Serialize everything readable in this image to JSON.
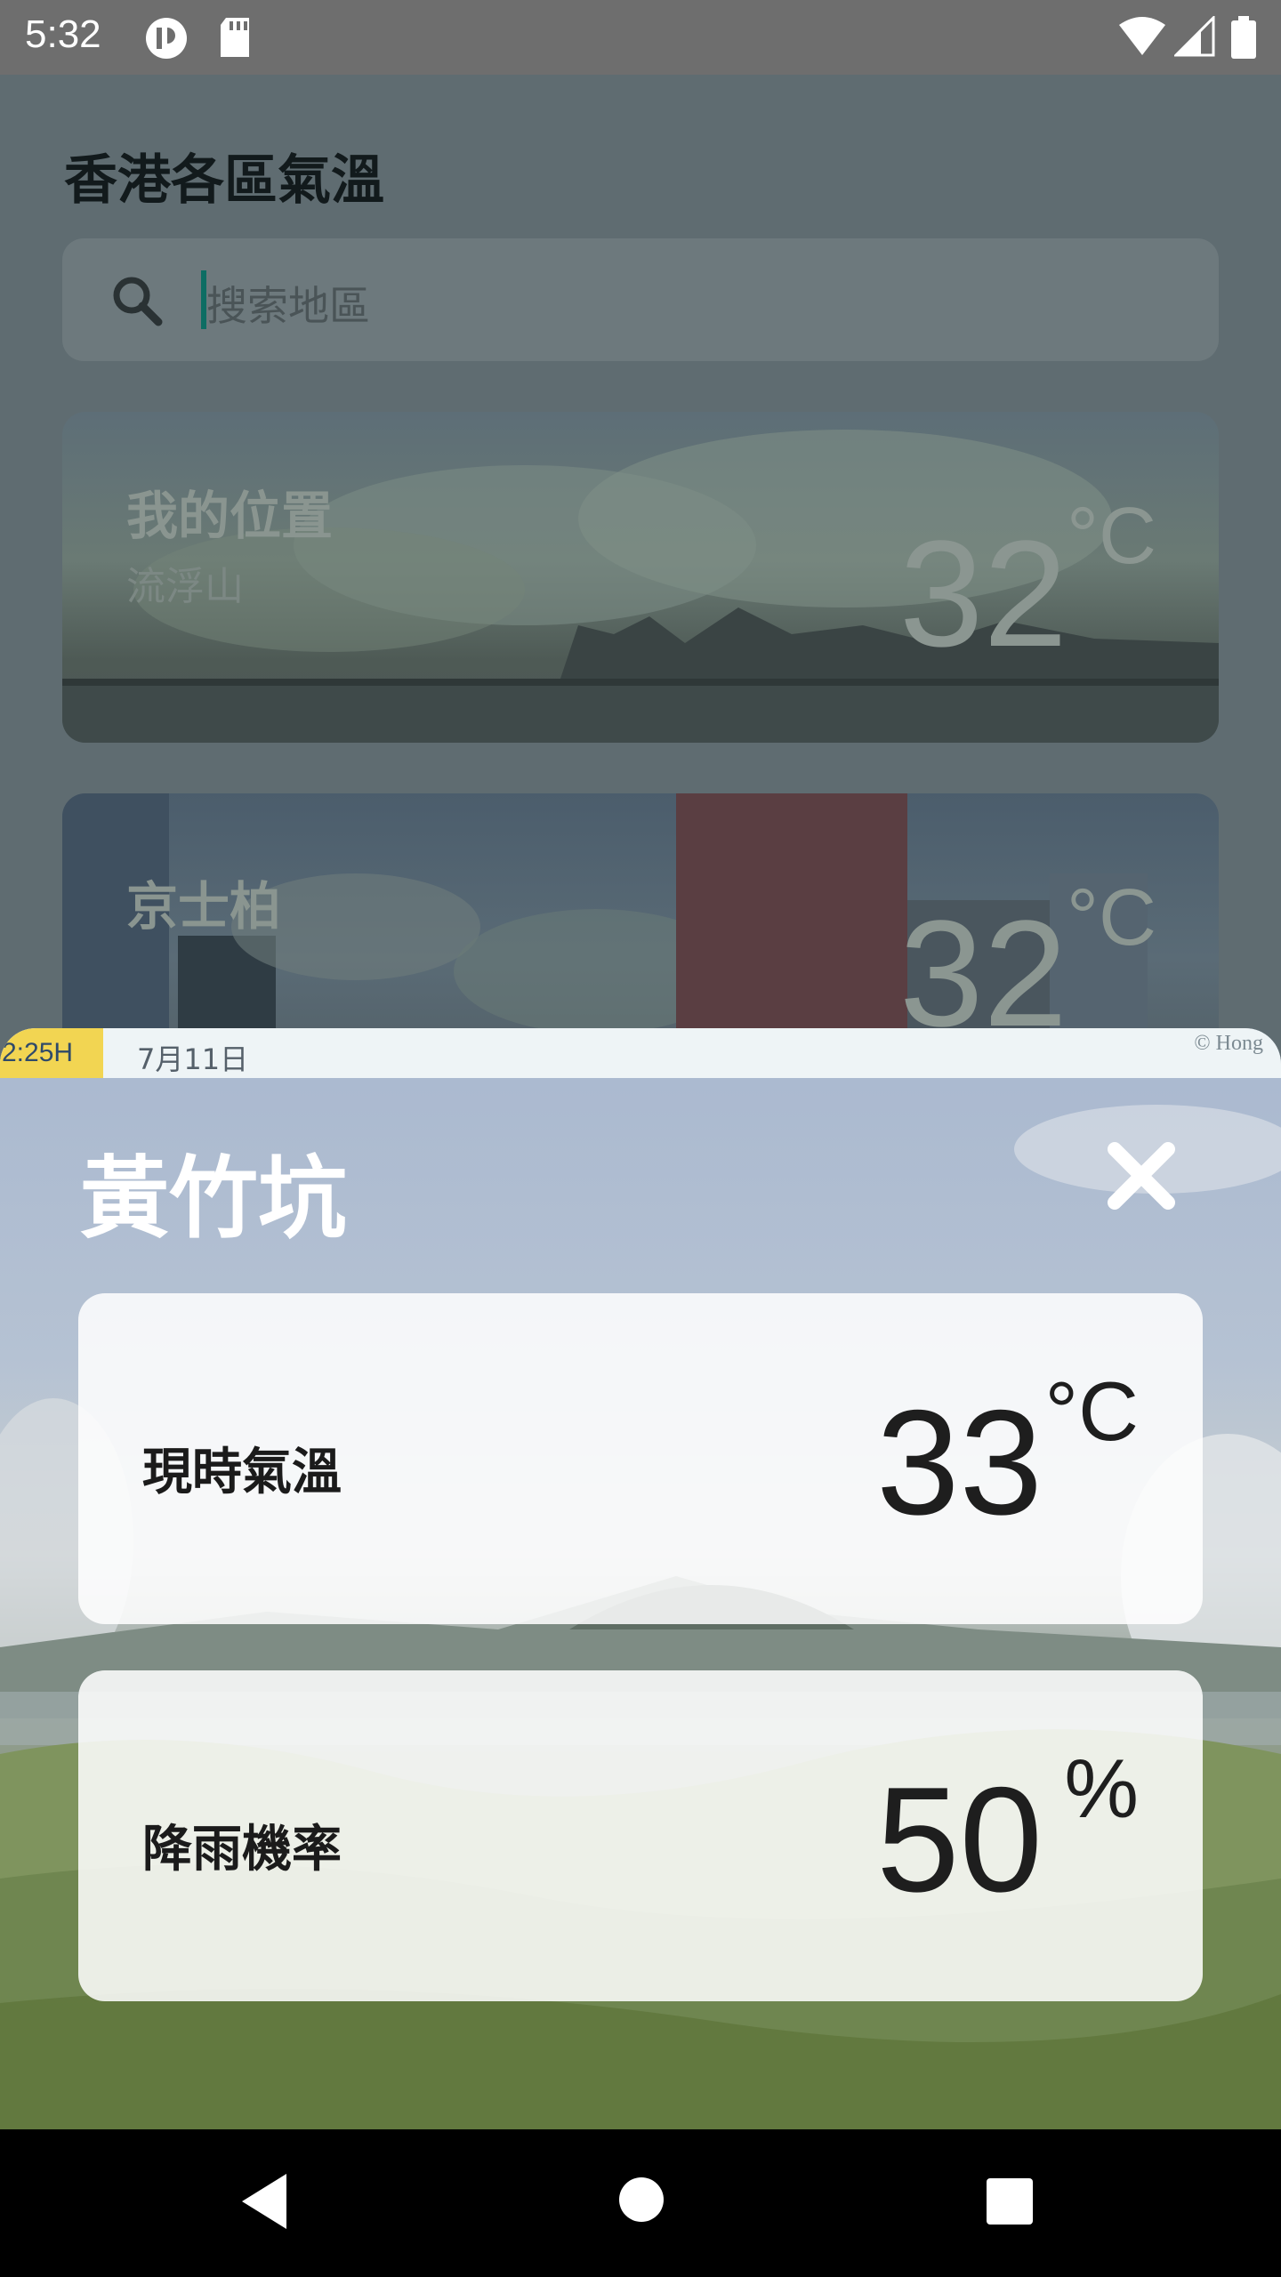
{
  "status_bar": {
    "time": "5:32",
    "icons": [
      "privacy-indicator-icon",
      "sd-card-icon",
      "wifi-icon",
      "signal-icon",
      "battery-icon"
    ]
  },
  "page": {
    "title": "香港各區氣溫",
    "search": {
      "placeholder": "搜索地區",
      "icon": "search-icon"
    },
    "cards": [
      {
        "name": "我的位置",
        "sub": "流浮山",
        "temp": "32",
        "unit": "°C"
      },
      {
        "name": "京士柏",
        "temp": "32",
        "unit": "°C"
      }
    ]
  },
  "sheet": {
    "webcam_time": "2:25H",
    "webcam_date": "7月11日",
    "webcam_copyright": "© Hong",
    "title": "黃竹坑",
    "close_icon": "close-icon",
    "current_temp": {
      "label": "現時氣溫",
      "value": "33",
      "unit": "°C"
    },
    "rain_chance": {
      "label": "降雨機率",
      "value": "50",
      "unit": "%"
    }
  },
  "nav_bar": {
    "back": "back-icon",
    "home": "home-icon",
    "recents": "recents-icon"
  },
  "colors": {
    "dim_overlay": "#5f6c71",
    "search_cursor": "#0d6d63",
    "card_background": "#ffffff",
    "badge_yellow": "#f2d552"
  }
}
